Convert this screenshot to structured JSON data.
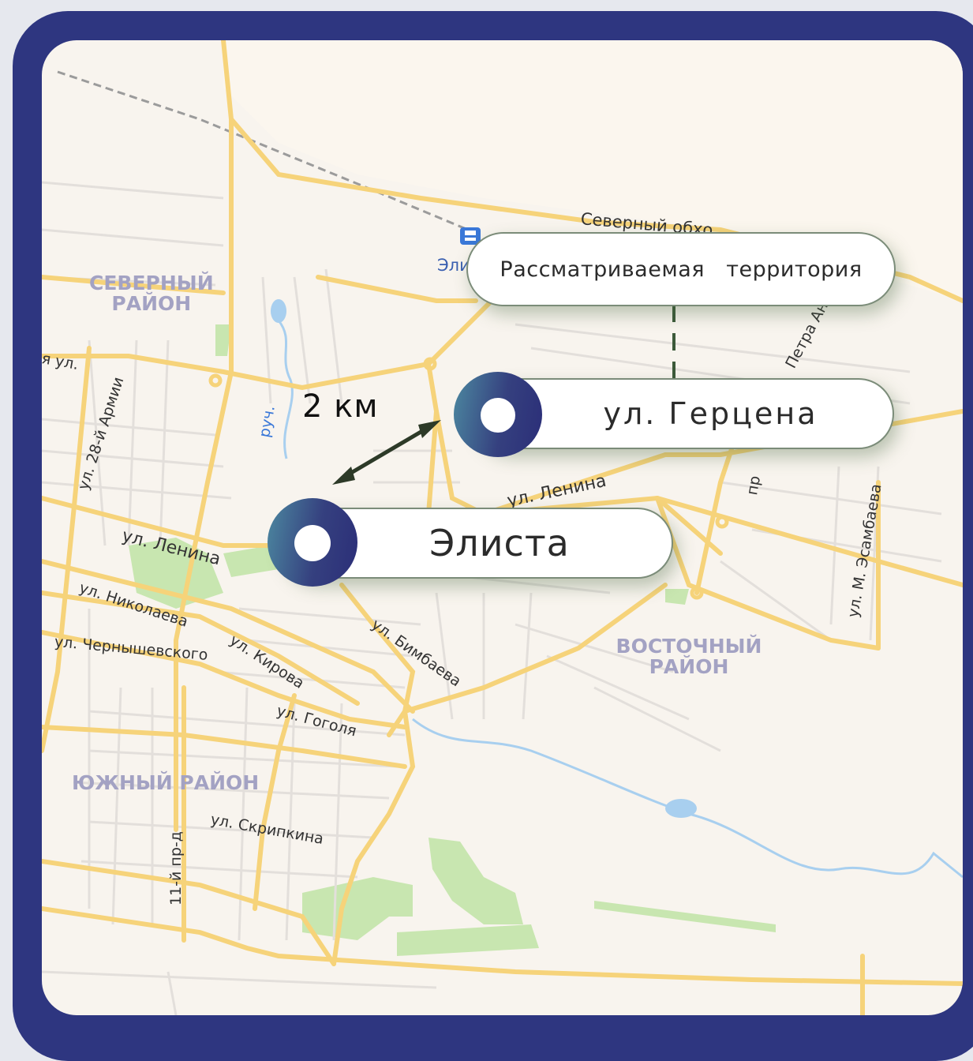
{
  "distance_label": "2 км",
  "labels": {
    "territory": "Рассматриваемая   территория",
    "gertsena": "ул. Герцена",
    "elista": "Элиста"
  },
  "districts": {
    "north": "СЕВЕРНЫЙ РАЙОН",
    "east": "ВОСТОЧНЫЙ РАЙОН",
    "south": "ЮЖНЫЙ РАЙОН"
  },
  "streets": {
    "severny_obkhod": "Северный обхо",
    "eli": "Эли",
    "lenina_west": "ул. Ленина",
    "lenina_east": "ул. Ленина",
    "nikolaeva": "ул. Николаева",
    "chernyshevskogo": "ул. Чернышевского",
    "kirova": "ул. Кирова",
    "bimbaeva": "ул. Бимбаева",
    "gogolya": "ул. Гоголя",
    "skripkina": "ул. Скрипкина",
    "armii28": "ул. 28-й Армии",
    "pr11": "11-й пр-д",
    "esambaeva": "ул. М. Эсамбаева",
    "petra_ana": "Петра Ана",
    "pr": "пр",
    "ruch": "руч.",
    "ya_ul": "я ул."
  },
  "colors": {
    "frame": "#2e3680",
    "road_major": "#f6d37a",
    "park": "#c8e6b0",
    "water": "#a8cfef"
  },
  "icons": [
    "map-marker-icon",
    "train-station-icon",
    "distance-arrow-icon"
  ]
}
